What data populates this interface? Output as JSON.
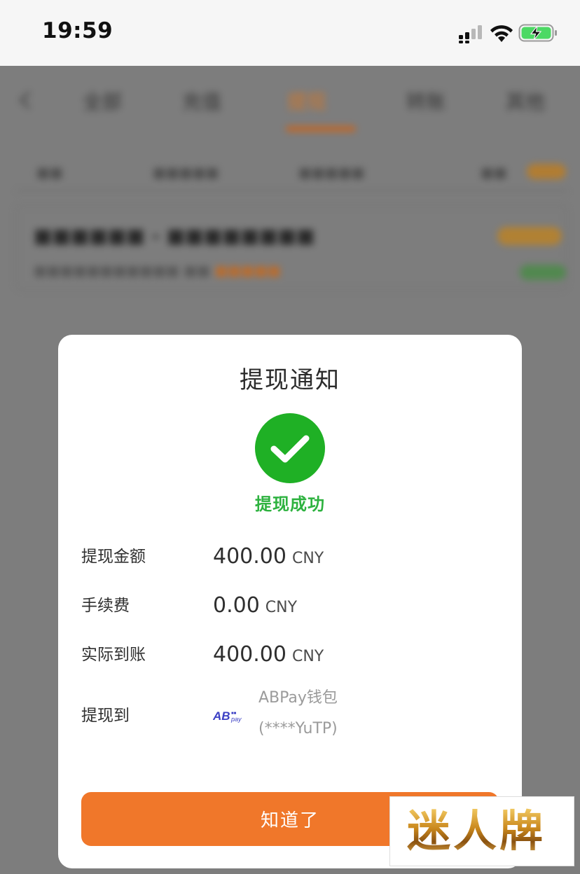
{
  "status_bar": {
    "time": "19:59",
    "icons": [
      "signal-icon",
      "wifi-icon",
      "battery-charging-icon"
    ],
    "battery_color": "#4cd964"
  },
  "background_app": {
    "tabs": [
      "全部",
      "充值",
      "提现",
      "转账",
      "其他"
    ],
    "active_tab_index": 2,
    "accent_color": "#f0772a"
  },
  "modal": {
    "title": "提现通知",
    "success_icon": "check-circle-icon",
    "success_color": "#1fb025",
    "success_text": "提现成功",
    "rows": [
      {
        "label": "提现金额",
        "amount": "400.00",
        "unit": "CNY"
      },
      {
        "label": "手续费",
        "amount": "0.00",
        "unit": "CNY"
      },
      {
        "label": "实际到账",
        "amount": "400.00",
        "unit": "CNY"
      }
    ],
    "destination": {
      "label": "提现到",
      "logo": "abpay-logo",
      "wallet_name": "ABPay钱包",
      "account": "(****YuTP)"
    },
    "confirm_label": "知道了",
    "confirm_color": "#f0772a"
  },
  "watermark": {
    "text": "迷人牌"
  }
}
